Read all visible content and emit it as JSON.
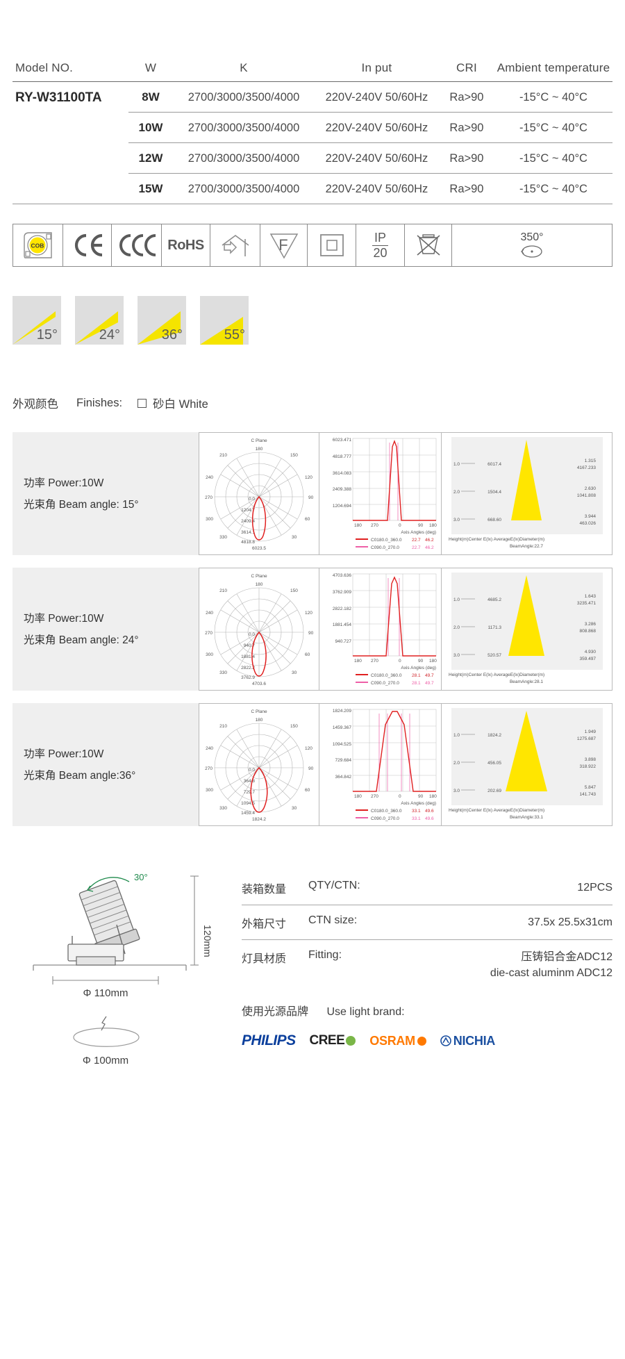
{
  "spec_table": {
    "headers": [
      "Model NO.",
      "W",
      "K",
      "In put",
      "CRI",
      "Ambient temperature"
    ],
    "model": "RY-W31100TA",
    "rows": [
      {
        "w": "8W",
        "k": "2700/3000/3500/4000",
        "input": "220V-240V 50/60Hz",
        "cri": "Ra>90",
        "amb": "-15°C ~ 40°C"
      },
      {
        "w": "10W",
        "k": "2700/3000/3500/4000",
        "input": "220V-240V 50/60Hz",
        "cri": "Ra>90",
        "amb": "-15°C ~ 40°C"
      },
      {
        "w": "12W",
        "k": "2700/3000/3500/4000",
        "input": "220V-240V 50/60Hz",
        "cri": "Ra>90",
        "amb": "-15°C ~ 40°C"
      },
      {
        "w": "15W",
        "k": "2700/3000/3500/4000",
        "input": "220V-240V 50/60Hz",
        "cri": "Ra>90",
        "amb": "-15°C ~ 40°C"
      }
    ]
  },
  "certifications": [
    {
      "name": "cob-icon",
      "label": "COB"
    },
    {
      "name": "ce-icon",
      "label": "CE"
    },
    {
      "name": "ccc-icon",
      "label": "CCC"
    },
    {
      "name": "rohs-icon",
      "label": "RoHS"
    },
    {
      "name": "indoor-use-icon",
      "label": ""
    },
    {
      "name": "f-mark-icon",
      "label": "F"
    },
    {
      "name": "class-two-icon",
      "label": ""
    },
    {
      "name": "ip-rating-icon",
      "label_top": "IP",
      "label_bottom": "20"
    },
    {
      "name": "weee-icon",
      "label": ""
    },
    {
      "name": "rotation-icon",
      "label": "350°"
    }
  ],
  "beam_angles": [
    {
      "label": "15°",
      "spread": 15
    },
    {
      "label": "24°",
      "spread": 24
    },
    {
      "label": "36°",
      "spread": 36
    },
    {
      "label": "55°",
      "spread": 55
    }
  ],
  "finishes": {
    "cn": "外观颜色",
    "en": "Finishes:",
    "option": "砂白 White"
  },
  "photometrics": [
    {
      "power_cn": "功率 Power:10W",
      "beam_cn": "光束角 Beam angle: 15°",
      "polar": {
        "title": "C Plane",
        "angles": [
          "180",
          "150",
          "120",
          "90",
          "60",
          "30",
          "0",
          "330",
          "300",
          "270",
          "240",
          "210"
        ],
        "radial_labels": [
          "0.0",
          "1204.7",
          "2409.4",
          "3614.1",
          "4818.8",
          "6023.5"
        ]
      },
      "cartesian": {
        "y_labels": [
          "6023.471",
          "4818.777",
          "3614.083",
          "2409.388",
          "1204.694"
        ],
        "x_labels": [
          "180",
          "270",
          "0",
          "90",
          "180"
        ],
        "x_axis_title": "Axis Angles  (deg)",
        "legend": [
          {
            "name": "C0180.0_360.0",
            "v1": "22.7",
            "v2": "46.2",
            "color": "#e02020"
          },
          {
            "name": "C090.0_270.0",
            "v1": "22.7",
            "v2": "46.2",
            "color": "#ee5fa7"
          }
        ]
      },
      "cone": {
        "rows": [
          {
            "height": "1.0",
            "center": "6017.4",
            "diameter": "1.315",
            "avg": "4167.233"
          },
          {
            "height": "2.0",
            "center": "1504.4",
            "diameter": "2.630",
            "avg": "1041.808"
          },
          {
            "height": "3.0",
            "center": "668.60",
            "diameter": "3.944",
            "avg": "463.026"
          }
        ],
        "footer": "Height(m)Center E(lx)    AverageE(lx)Diameter(m)",
        "beam_angle": "BeamAngle:22.7"
      }
    },
    {
      "power_cn": "功率 Power:10W",
      "beam_cn": "光束角 Beam angle: 24°",
      "polar": {
        "title": "C Plane",
        "angles": [
          "180",
          "150",
          "120",
          "90",
          "60",
          "30",
          "0",
          "330",
          "300",
          "270",
          "240",
          "210"
        ],
        "radial_labels": [
          "0.0",
          "940.7",
          "1881.4",
          "2822.2",
          "3762.9",
          "4703.6"
        ]
      },
      "cartesian": {
        "y_labels": [
          "4703.636",
          "3762.909",
          "2822.182",
          "1881.454",
          "940.727"
        ],
        "x_labels": [
          "180",
          "270",
          "0",
          "90",
          "180"
        ],
        "x_axis_title": "Axis Angles  (deg)",
        "legend": [
          {
            "name": "C0180.0_360.0",
            "v1": "28.1",
            "v2": "49.7",
            "color": "#e02020"
          },
          {
            "name": "C090.0_270.0",
            "v1": "28.1",
            "v2": "49.7",
            "color": "#ee5fa7"
          }
        ]
      },
      "cone": {
        "rows": [
          {
            "height": "1.0",
            "center": "4685.2",
            "diameter": "1.643",
            "avg": "3235.471"
          },
          {
            "height": "2.0",
            "center": "1171.3",
            "diameter": "3.286",
            "avg": "808.868"
          },
          {
            "height": "3.0",
            "center": "520.57",
            "diameter": "4.930",
            "avg": "359.497"
          }
        ],
        "footer": "Height(m)Center E(lx)    AverageE(lx)Diameter(m)",
        "beam_angle": "BeamAngle:28.1"
      }
    },
    {
      "power_cn": "功率 Power:10W",
      "beam_cn": "光束角 Beam angle:36°",
      "polar": {
        "title": "C Plane",
        "angles": [
          "180",
          "150",
          "120",
          "90",
          "60",
          "30",
          "0",
          "330",
          "300",
          "270",
          "240",
          "210"
        ],
        "radial_labels": [
          "0.0",
          "364.8",
          "729.7",
          "1094.5",
          "1459.4",
          "1824.2"
        ]
      },
      "cartesian": {
        "y_labels": [
          "1824.209",
          "1459.367",
          "1094.525",
          "729.684",
          "364.842"
        ],
        "x_labels": [
          "180",
          "270",
          "0",
          "90",
          "180"
        ],
        "x_axis_title": "Axis Angles  (deg)",
        "legend": [
          {
            "name": "C0180.0_360.0",
            "v1": "33.1",
            "v2": "49.6",
            "color": "#e02020"
          },
          {
            "name": "C090.0_270.0",
            "v1": "33.1",
            "v2": "49.6",
            "color": "#ee5fa7"
          }
        ]
      },
      "cone": {
        "rows": [
          {
            "height": "1.0",
            "center": "1824.2",
            "diameter": "1.949",
            "avg": "1275.687"
          },
          {
            "height": "2.0",
            "center": "456.05",
            "diameter": "3.898",
            "avg": "318.922"
          },
          {
            "height": "3.0",
            "center": "202.69",
            "diameter": "5.847",
            "avg": "141.743"
          }
        ],
        "footer": "Height(m)Center E(lx)    AverageE(lx)Diameter(m)",
        "beam_angle": "BeamAngle:33.1"
      }
    }
  ],
  "drawing": {
    "tilt_label": "30°",
    "height_label": "120mm",
    "outer_diameter": "Φ 110mm",
    "cutout_diameter": "Φ 100mm"
  },
  "packing": {
    "rows": [
      {
        "cn": "装箱数量",
        "en": "QTY/CTN:",
        "value": "12PCS"
      },
      {
        "cn": "外箱尺寸",
        "en": "CTN size:",
        "value": "37.5x 25.5x31cm"
      },
      {
        "cn": "灯具材质",
        "en": "Fitting:",
        "value": "压铸铝合金ADC12\ndie-cast aluminm ADC12"
      }
    ],
    "brand_head_cn": "使用光源品牌",
    "brand_head_en": "Use light brand:",
    "brands": [
      "PHILIPS",
      "CREE",
      "OSRAM",
      "NICHIA"
    ]
  },
  "colors": {
    "accent_yellow": "#f5e400",
    "swatch_gray": "#dedede",
    "curve_red": "#e02020",
    "curve_pink": "#ee5fa7"
  }
}
